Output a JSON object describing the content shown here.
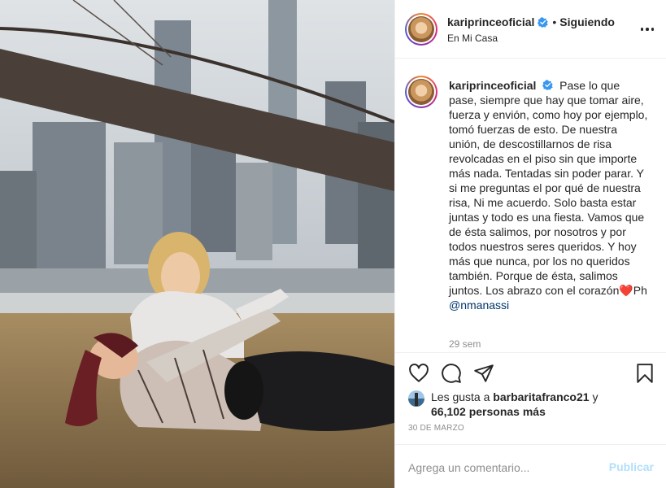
{
  "post": {
    "username": "kariprinceoficial",
    "verified": true,
    "follow_status": "Siguiendo",
    "location": "En Mi Casa",
    "caption": "Pase lo que pase, siempre que hay que tomar aire, fuerza y envión, como hoy por ejemplo, tomó fuerzas de esto. De nuestra unión, de descostillarnos de risa revolcadas en el piso sin que importe más nada. Tentadas sin poder parar. Y si me preguntas el por qué de nuestra risa, Ni me acuerdo. Solo basta estar juntas y todo es una fiesta. Vamos que de ésta salimos, por nosotros y por todos nuestros seres queridos. Y hoy más que nunca, por los no queridos también. Porque de ésta, salimos juntos. Los abrazo con el corazón",
    "caption_emoji": "❤️",
    "caption_suffix": "Ph",
    "mention": "@nmanassi",
    "time_ago": "29 sem",
    "likes_prefix": "Les gusta a",
    "liked_by": "barbaritafranco21",
    "likes_and": "y",
    "likes_others": "66,102 personas más",
    "date": "30 DE MARZO",
    "comment_placeholder": "Agrega un comentario...",
    "publish_label": "Publicar"
  },
  "icons": {
    "like": "heart-outline-icon",
    "comment": "speech-bubble-icon",
    "share": "paper-plane-icon",
    "save": "bookmark-icon",
    "more": "more-options-icon",
    "verified": "verified-badge-icon"
  },
  "colors": {
    "text": "#262626",
    "secondary": "#8e8e8e",
    "verified_blue": "#3897f0",
    "mention": "#00376b",
    "publish_disabled": "#b2dffc",
    "border": "#efefef"
  }
}
